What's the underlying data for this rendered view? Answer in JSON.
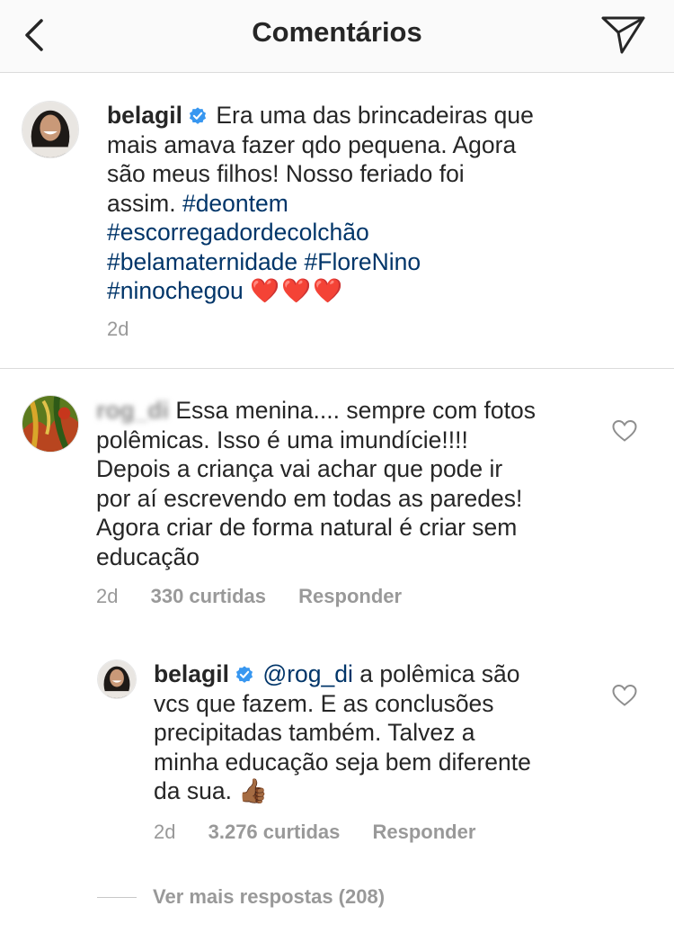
{
  "header": {
    "title": "Comentários",
    "back_icon": "chevron-left-icon",
    "send_icon": "paper-plane-icon"
  },
  "caption": {
    "username": "belagil",
    "text_lines": [
      "Era uma das brincadeiras que",
      "mais amava fazer qdo pequena. Agora",
      "são meus filhos! Nosso feriado foi",
      "assim."
    ],
    "hashtags": [
      "#deontem",
      "#escorregadordecolchão",
      "#belamaternidade",
      "#FloreNino",
      "#ninochegou"
    ],
    "emoji": "❤️❤️❤️",
    "time": "2d"
  },
  "comment": {
    "username": "rog_di",
    "text_lines": [
      "Essa menina.... sempre com fotos",
      "polêmicas. Isso é uma imundície!!!!",
      "Depois a criança vai achar que pode ir",
      "por aí escrevendo em todas as paredes!",
      "Agora criar de forma natural é criar sem",
      "educação"
    ],
    "time": "2d",
    "likes": "330 curtidas",
    "reply_label": "Responder"
  },
  "reply": {
    "username": "belagil",
    "mention": "@rog_di",
    "text_lines": [
      "a polêmica são",
      "vcs que fazem. E as conclusões",
      "precipitadas também. Talvez a",
      "minha educação seja bem diferente",
      "da sua."
    ],
    "emoji": "👍🏾",
    "time": "2d",
    "likes": "3.276 curtidas",
    "reply_label": "Responder"
  },
  "more_replies": "Ver mais respostas (208)",
  "colors": {
    "hashtag": "#003569",
    "verified": "#3897f0",
    "meta": "#999999",
    "divider": "#dbdbdb"
  }
}
